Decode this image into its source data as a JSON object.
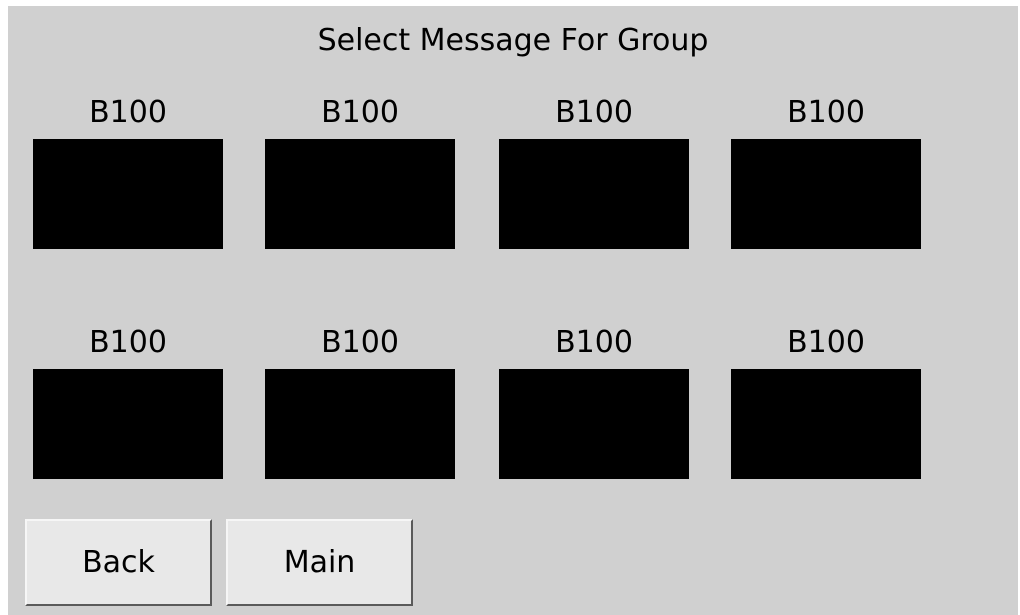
{
  "screen": {
    "title": "Select Message For Group"
  },
  "message_slots": [
    {
      "label": "B100"
    },
    {
      "label": "B100"
    },
    {
      "label": "B100"
    },
    {
      "label": "B100"
    },
    {
      "label": "B100"
    },
    {
      "label": "B100"
    },
    {
      "label": "B100"
    },
    {
      "label": "B100"
    }
  ],
  "nav": {
    "back_label": "Back",
    "main_label": "Main"
  },
  "colors": {
    "background": "#d0d0d0",
    "slot": "#000000",
    "button": "#e8e8e8"
  }
}
